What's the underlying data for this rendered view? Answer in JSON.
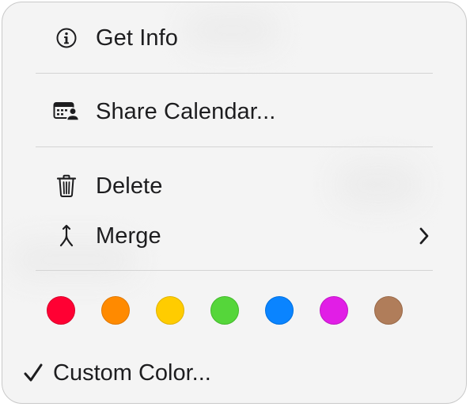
{
  "menu": {
    "items": [
      {
        "label": "Get Info",
        "icon": "info-circle-icon"
      },
      {
        "label": "Share Calendar...",
        "icon": "share-calendar-icon"
      },
      {
        "label": "Delete",
        "icon": "trash-icon"
      },
      {
        "label": "Merge",
        "icon": "merge-icon",
        "submenu": true
      }
    ],
    "colors": [
      {
        "name": "red",
        "hex": "#ff0033",
        "border": "#d8002b"
      },
      {
        "name": "orange",
        "hex": "#ff8a00",
        "border": "#e07800"
      },
      {
        "name": "yellow",
        "hex": "#ffcc00",
        "border": "#e0b200"
      },
      {
        "name": "green",
        "hex": "#55d63a",
        "border": "#44b92c"
      },
      {
        "name": "blue",
        "hex": "#0a84ff",
        "border": "#0070e0"
      },
      {
        "name": "purple",
        "hex": "#e11ee6",
        "border": "#c116c6"
      },
      {
        "name": "brown",
        "hex": "#b07d5a",
        "border": "#9a6a4a"
      }
    ],
    "custom_color": {
      "label": "Custom Color...",
      "checked": true
    }
  }
}
